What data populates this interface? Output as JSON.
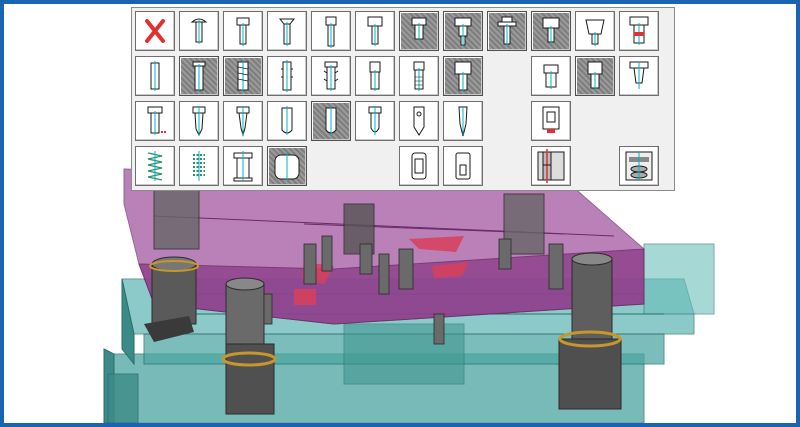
{
  "palette": {
    "rows": [
      [
        "cancel-x",
        "screw-round-head",
        "screw-socket-head",
        "screw-countersunk",
        "screw-socket-long",
        "screw-socket-cap",
        "screw-hex-head",
        "screw-shoulder-pressed",
        "screw-flange-pressed",
        "screw-cap-pressed",
        "guide-pillar-dome",
        "guide-pillar-plain"
      ],
      [
        "pin-dowel",
        "pin-ejector-pressed",
        "pin-knurled-pressed",
        "pin-grooved",
        "pin-barbed",
        "pin-stepped",
        "pin-threaded",
        "pin-cap-pressed",
        "empty",
        "bush-plain",
        "bush-pressed",
        "bush-collar"
      ],
      [
        "pin-punch-tagged",
        "punch-tapered",
        "punch-pointed",
        "punch-rounded",
        "punch-round-pressed",
        "punch-bullet",
        "punch-hole",
        "punch-needle",
        "empty",
        "bush-stepped-sleeve",
        "empty",
        "empty"
      ],
      [
        "spring-coil",
        "spring-stack",
        "stripper-bolt-spring",
        "cylinder-block-pressed",
        "empty",
        "empty",
        "sleeve-slotted",
        "sleeve-hex",
        "empty",
        "guide-assembly-section",
        "empty",
        "nitrogen-spring-group"
      ]
    ]
  },
  "colors": {
    "frame_border": "#1a64b4",
    "die_shoe_teal": "#47a3a0",
    "stripper_plate_magenta": "#a14f9e",
    "accent_red": "#e03030",
    "icon_cyan": "#00b4cc"
  }
}
